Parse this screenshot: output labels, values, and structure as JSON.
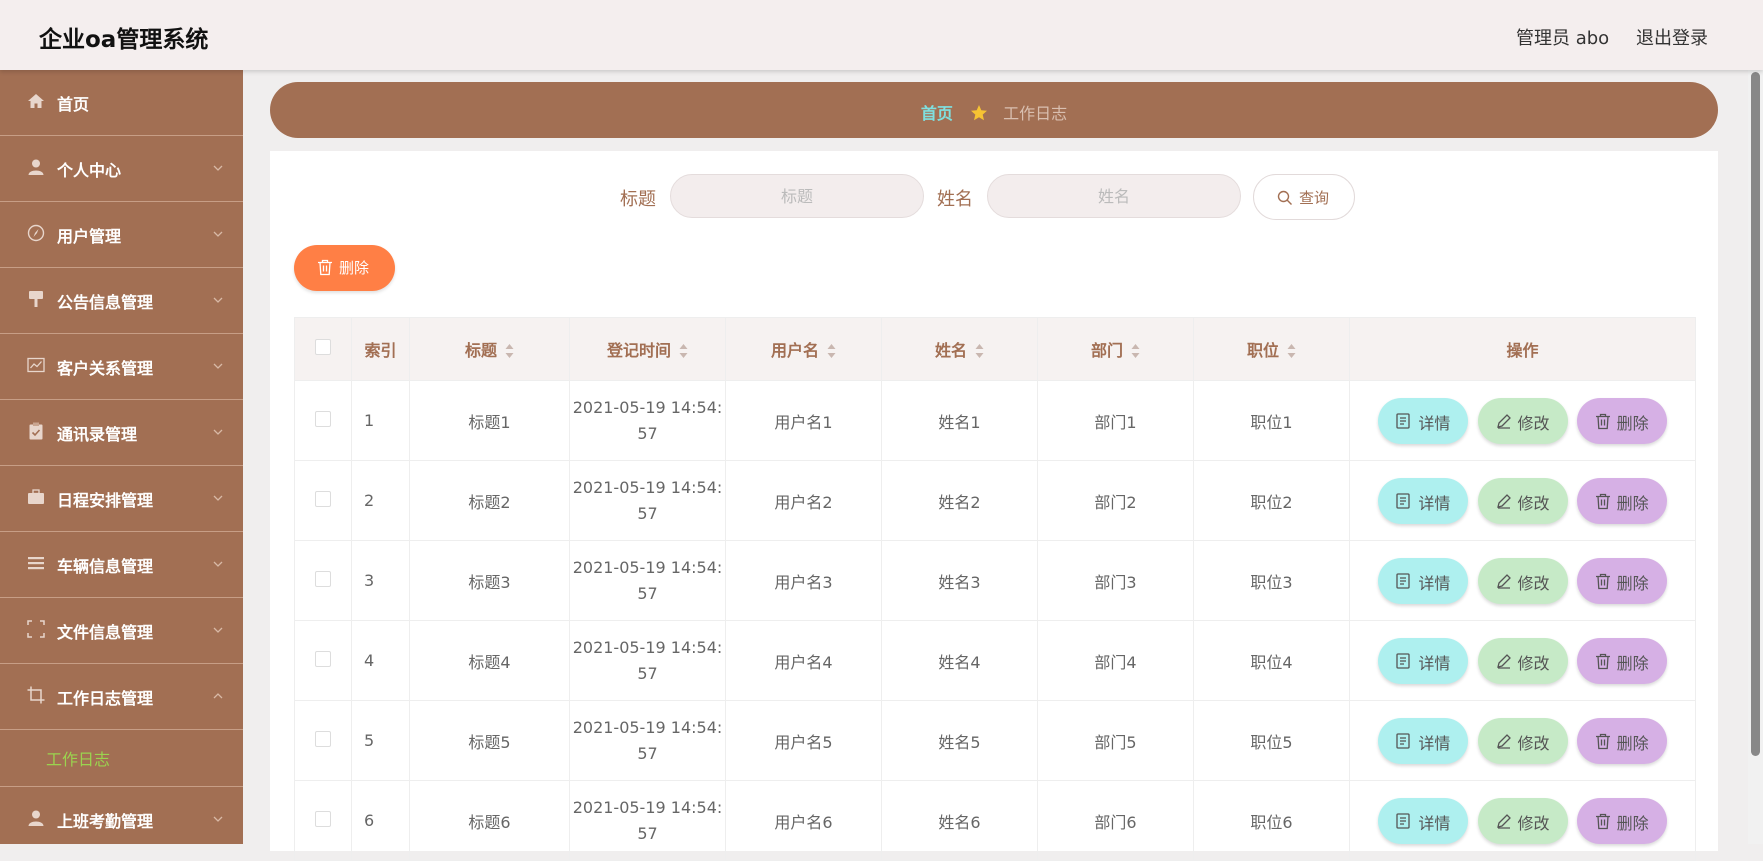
{
  "header": {
    "title": "企业oa管理系统",
    "user": "管理员 abo",
    "logout": "退出登录"
  },
  "sidebar": {
    "items": [
      {
        "label": "首页",
        "icon": "home-icon"
      },
      {
        "label": "个人中心",
        "icon": "user-icon"
      },
      {
        "label": "用户管理",
        "icon": "compass-icon"
      },
      {
        "label": "公告信息管理",
        "icon": "brush-icon"
      },
      {
        "label": "客户关系管理",
        "icon": "chart-icon"
      },
      {
        "label": "通讯录管理",
        "icon": "clipboard-icon"
      },
      {
        "label": "日程安排管理",
        "icon": "briefcase-icon"
      },
      {
        "label": "车辆信息管理",
        "icon": "list-icon"
      },
      {
        "label": "文件信息管理",
        "icon": "frame-icon"
      },
      {
        "label": "工作日志管理",
        "icon": "crop-icon"
      },
      {
        "label": "上班考勤管理",
        "icon": "user-icon"
      }
    ],
    "active_sub": "工作日志"
  },
  "breadcrumb": {
    "home": "首页",
    "current": "工作日志"
  },
  "filter": {
    "title_label": "标题",
    "title_placeholder": "标题",
    "name_label": "姓名",
    "name_placeholder": "姓名",
    "query": "查询"
  },
  "toolbar": {
    "delete": "删除"
  },
  "table": {
    "headers": [
      "索引",
      "标题",
      "登记时间",
      "用户名",
      "姓名",
      "部门",
      "职位",
      "操作"
    ],
    "actions": {
      "detail": "详情",
      "edit": "修改",
      "delete": "删除"
    },
    "rows": [
      {
        "index": "1",
        "title": "标题1",
        "time_a": "2021-05-19 14:54:",
        "time_b": "57",
        "username": "用户名1",
        "name": "姓名1",
        "dept": "部门1",
        "position": "职位1"
      },
      {
        "index": "2",
        "title": "标题2",
        "time_a": "2021-05-19 14:54:",
        "time_b": "57",
        "username": "用户名2",
        "name": "姓名2",
        "dept": "部门2",
        "position": "职位2"
      },
      {
        "index": "3",
        "title": "标题3",
        "time_a": "2021-05-19 14:54:",
        "time_b": "57",
        "username": "用户名3",
        "name": "姓名3",
        "dept": "部门3",
        "position": "职位3"
      },
      {
        "index": "4",
        "title": "标题4",
        "time_a": "2021-05-19 14:54:",
        "time_b": "57",
        "username": "用户名4",
        "name": "姓名4",
        "dept": "部门4",
        "position": "职位4"
      },
      {
        "index": "5",
        "title": "标题5",
        "time_a": "2021-05-19 14:54:",
        "time_b": "57",
        "username": "用户名5",
        "name": "姓名5",
        "dept": "部门5",
        "position": "职位5"
      },
      {
        "index": "6",
        "title": "标题6",
        "time_a": "2021-05-19 14:54:",
        "time_b": "57",
        "username": "用户名6",
        "name": "姓名6",
        "dept": "部门6",
        "position": "职位6"
      }
    ]
  },
  "colors": {
    "brand": "#a26f53",
    "header_bg": "#f4eeee",
    "delete_orange": "#ff7f45",
    "detail": "#aef0ef",
    "edit": "#c6eac7",
    "delete_row": "#d6b0e5",
    "sub_active": "#9bd34f",
    "breadcrumb_home": "#7fe0e0"
  }
}
